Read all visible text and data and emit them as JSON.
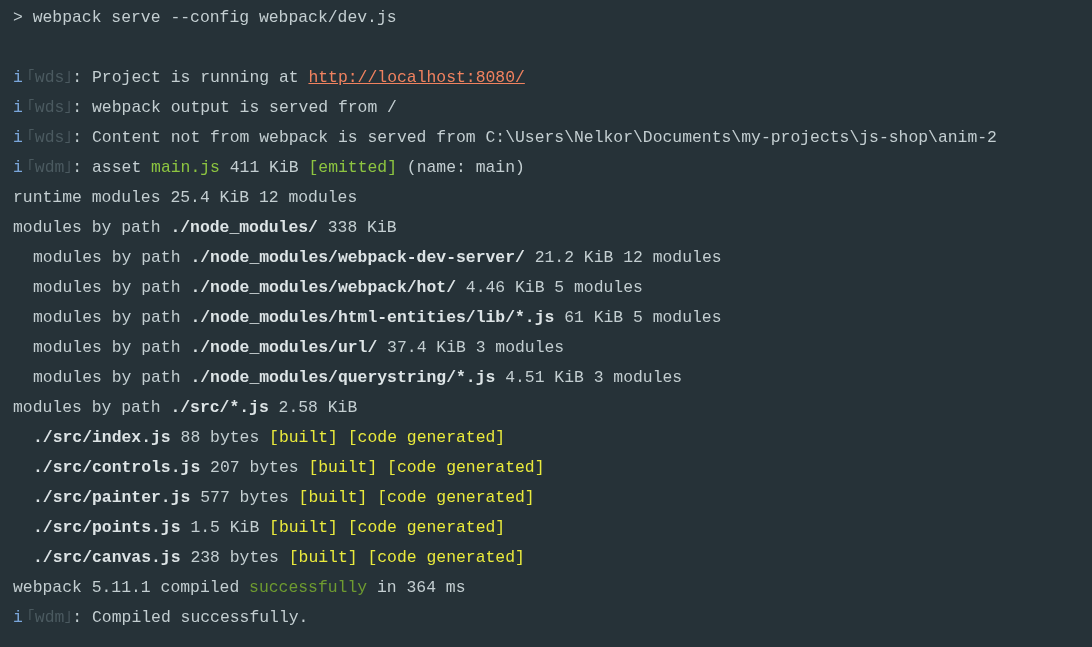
{
  "command": {
    "prompt": ">",
    "text": "webpack serve --config webpack/dev.js"
  },
  "output": [
    {
      "segments": [
        {
          "kind": "info",
          "text": "i"
        },
        {
          "kind": "tag",
          "text": "｢wds｣"
        },
        {
          "kind": "plain",
          "text": ": Project is running at "
        },
        {
          "kind": "link",
          "text": "http://localhost:8080/"
        }
      ]
    },
    {
      "segments": [
        {
          "kind": "info",
          "text": "i"
        },
        {
          "kind": "tag",
          "text": "｢wds｣"
        },
        {
          "kind": "plain",
          "text": ": webpack output is served from /"
        }
      ]
    },
    {
      "segments": [
        {
          "kind": "info",
          "text": "i"
        },
        {
          "kind": "tag",
          "text": "｢wds｣"
        },
        {
          "kind": "plain",
          "text": ": Content not from webpack is served from C:\\Users\\Nelkor\\Documents\\my-projects\\js-shop\\anim-2"
        }
      ]
    },
    {
      "segments": [
        {
          "kind": "info",
          "text": "i"
        },
        {
          "kind": "tag",
          "text": "｢wdm｣"
        },
        {
          "kind": "plain",
          "text": ": asset "
        },
        {
          "kind": "green",
          "text": "main.js"
        },
        {
          "kind": "plain",
          "text": " 411 KiB "
        },
        {
          "kind": "green",
          "text": "[emitted]"
        },
        {
          "kind": "plain",
          "text": " (name: main)"
        }
      ]
    },
    {
      "segments": [
        {
          "kind": "plain",
          "text": "runtime modules 25.4 KiB 12 modules"
        }
      ]
    },
    {
      "segments": [
        {
          "kind": "plain",
          "text": "modules by path "
        },
        {
          "kind": "bold",
          "text": "./node_modules/"
        },
        {
          "kind": "plain",
          "text": " 338 KiB"
        }
      ],
      "children": [
        {
          "segments": [
            {
              "kind": "plain",
              "text": "modules by path "
            },
            {
              "kind": "bold",
              "text": "./node_modules/webpack-dev-server/"
            },
            {
              "kind": "plain",
              "text": " 21.2 KiB 12 modules"
            }
          ]
        },
        {
          "segments": [
            {
              "kind": "plain",
              "text": "modules by path "
            },
            {
              "kind": "bold",
              "text": "./node_modules/webpack/hot/"
            },
            {
              "kind": "plain",
              "text": " 4.46 KiB 5 modules"
            }
          ]
        },
        {
          "segments": [
            {
              "kind": "plain",
              "text": "modules by path "
            },
            {
              "kind": "bold",
              "text": "./node_modules/html-entities/lib/*.js"
            },
            {
              "kind": "plain",
              "text": " 61 KiB 5 modules"
            }
          ]
        },
        {
          "segments": [
            {
              "kind": "plain",
              "text": "modules by path "
            },
            {
              "kind": "bold",
              "text": "./node_modules/url/"
            },
            {
              "kind": "plain",
              "text": " 37.4 KiB 3 modules"
            }
          ]
        },
        {
          "segments": [
            {
              "kind": "plain",
              "text": "modules by path "
            },
            {
              "kind": "bold",
              "text": "./node_modules/querystring/*.js"
            },
            {
              "kind": "plain",
              "text": " 4.51 KiB 3 modules"
            }
          ]
        }
      ]
    },
    {
      "segments": [
        {
          "kind": "plain",
          "text": "modules by path "
        },
        {
          "kind": "bold",
          "text": "./src/*.js"
        },
        {
          "kind": "plain",
          "text": " 2.58 KiB"
        }
      ],
      "children": [
        {
          "segments": [
            {
              "kind": "bold",
              "text": "./src/index.js"
            },
            {
              "kind": "plain",
              "text": " 88 bytes "
            },
            {
              "kind": "yellow",
              "text": "[built] [code generated]"
            }
          ]
        },
        {
          "segments": [
            {
              "kind": "bold",
              "text": "./src/controls.js"
            },
            {
              "kind": "plain",
              "text": " 207 bytes "
            },
            {
              "kind": "yellow",
              "text": "[built] [code generated]"
            }
          ]
        },
        {
          "segments": [
            {
              "kind": "bold",
              "text": "./src/painter.js"
            },
            {
              "kind": "plain",
              "text": " 577 bytes "
            },
            {
              "kind": "yellow",
              "text": "[built] [code generated]"
            }
          ]
        },
        {
          "segments": [
            {
              "kind": "bold",
              "text": "./src/points.js"
            },
            {
              "kind": "plain",
              "text": " 1.5 KiB "
            },
            {
              "kind": "yellow",
              "text": "[built] [code generated]"
            }
          ]
        },
        {
          "segments": [
            {
              "kind": "bold",
              "text": "./src/canvas.js"
            },
            {
              "kind": "plain",
              "text": " 238 bytes "
            },
            {
              "kind": "yellow",
              "text": "[built] [code generated]"
            }
          ]
        }
      ]
    },
    {
      "segments": [
        {
          "kind": "plain",
          "text": "webpack 5.11.1 compiled "
        },
        {
          "kind": "darkgreen",
          "text": "successfully"
        },
        {
          "kind": "plain",
          "text": " in 364 ms"
        }
      ]
    },
    {
      "segments": [
        {
          "kind": "info",
          "text": "i"
        },
        {
          "kind": "tag",
          "text": "｢wdm｣"
        },
        {
          "kind": "plain",
          "text": ": Compiled successfully."
        }
      ]
    }
  ]
}
